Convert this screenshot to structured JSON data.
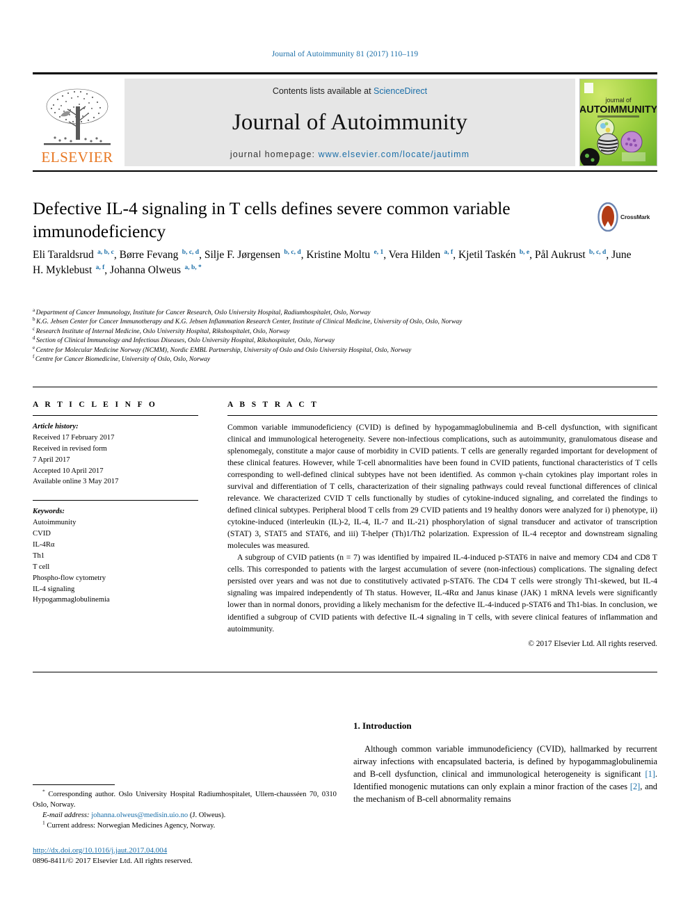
{
  "running_head": "Journal of Autoimmunity 81 (2017) 110–119",
  "masthead": {
    "publisher_name": "ELSEVIER",
    "contents_prefix": "Contents lists available at ",
    "contents_link": "ScienceDirect",
    "journal_title": "Journal of Autoimmunity",
    "homepage_prefix": "journal homepage: ",
    "homepage_url": "www.elsevier.com/locate/jautimm",
    "cover_line1": "journal of",
    "cover_line2": "AUTOIMMUNITY"
  },
  "badge": {
    "crossmark_label": "CrossMark"
  },
  "article": {
    "title": "Defective IL-4 signaling in T cells defines severe common variable immunodeficiency",
    "authors_html": "Eli Taraldsrud <sup>a, b, c</sup>, Børre Fevang <sup>b, c, d</sup>, Silje F. Jørgensen <sup>b, c, d</sup>, Kristine Moltu <sup>e, 1</sup>, Vera Hilden <sup>a, f</sup>, Kjetil Taskén <sup>b, e</sup>, Pål Aukrust <sup>b, c, d</sup>, June H. Myklebust <sup>a, f</sup>, Johanna Olweus <sup>a, b, *</sup>",
    "affiliations": [
      {
        "marker": "a",
        "text": "Department of Cancer Immunology, Institute for Cancer Research, Oslo University Hospital, Radiumhospitalet, Oslo, Norway"
      },
      {
        "marker": "b",
        "text": "K.G. Jebsen Center for Cancer Immunotherapy and K.G. Jebsen Inflammation Research Center, Institute of Clinical Medicine, University of Oslo, Oslo, Norway"
      },
      {
        "marker": "c",
        "text": "Research Institute of Internal Medicine, Oslo University Hospital, Rikshospitalet, Oslo, Norway"
      },
      {
        "marker": "d",
        "text": "Section of Clinical Immunology and Infectious Diseases, Oslo University Hospital, Rikshospitalet, Oslo, Norway"
      },
      {
        "marker": "e",
        "text": "Centre for Molecular Medicine Norway (NCMM), Nordic EMBL Partnership, University of Oslo and Oslo University Hospital, Oslo, Norway"
      },
      {
        "marker": "f",
        "text": "Centre for Cancer Biomedicine, University of Oslo, Oslo, Norway"
      }
    ]
  },
  "article_info": {
    "heading": "A R T I C L E   I N F O",
    "history_label": "Article history:",
    "history": [
      "Received 17 February 2017",
      "Received in revised form",
      "7 April 2017",
      "Accepted 10 April 2017",
      "Available online 3 May 2017"
    ],
    "keywords_label": "Keywords:",
    "keywords": [
      "Autoimmunity",
      "CVID",
      "IL-4Rα",
      "Th1",
      "T cell",
      "Phospho-flow cytometry",
      "IL-4 signaling",
      "Hypogammaglobulinemia"
    ]
  },
  "abstract": {
    "heading": "A B S T R A C T",
    "paragraphs": [
      "Common variable immunodeficiency (CVID) is defined by hypogammaglobulinemia and B-cell dysfunction, with significant clinical and immunological heterogeneity. Severe non-infectious complications, such as autoimmunity, granulomatous disease and splenomegaly, constitute a major cause of morbidity in CVID patients. T cells are generally regarded important for development of these clinical features. However, while T-cell abnormalities have been found in CVID patients, functional characteristics of T cells corresponding to well-defined clinical subtypes have not been identified. As common γ-chain cytokines play important roles in survival and differentiation of T cells, characterization of their signaling pathways could reveal functional differences of clinical relevance. We characterized CVID T cells functionally by studies of cytokine-induced signaling, and correlated the findings to defined clinical subtypes. Peripheral blood T cells from 29 CVID patients and 19 healthy donors were analyzed for i) phenotype, ii) cytokine-induced (interleukin (IL)-2, IL-4, IL-7 and IL-21) phosphorylation of signal transducer and activator of transcription (STAT) 3, STAT5 and STAT6, and iii) T-helper (Th)1/Th2 polarization. Expression of IL-4 receptor and downstream signaling molecules was measured.",
      "A subgroup of CVID patients (n = 7) was identified by impaired IL-4-induced p-STAT6 in naive and memory CD4 and CD8 T cells. This corresponded to patients with the largest accumulation of severe (non-infectious) complications. The signaling defect persisted over years and was not due to constitutively activated p-STAT6. The CD4 T cells were strongly Th1-skewed, but IL-4 signaling was impaired independently of Th status. However, IL-4Rα and Janus kinase (JAK) 1 mRNA levels were significantly lower than in normal donors, providing a likely mechanism for the defective IL-4-induced p-STAT6 and Th1-bias. In conclusion, we identified a subgroup of CVID patients with defective IL-4 signaling in T cells, with severe clinical features of inflammation and autoimmunity."
    ],
    "copyright": "© 2017 Elsevier Ltd. All rights reserved."
  },
  "body": {
    "section_heading": "1. Introduction",
    "paragraph_html": "Although common variable immunodeficiency (CVID), hallmarked by recurrent airway infections with encapsulated bacteria, is defined by hypogammaglobulinemia and B-cell dysfunction, clinical and immunological heterogeneity is significant <span class=\"ref\">[1]</span>. Identified monogenic mutations can only explain a minor fraction of the cases <span class=\"ref\">[2]</span>, and the mechanism of B-cell abnormality remains"
  },
  "footnotes": {
    "corresponding_marker": "*",
    "corresponding_text": "Corresponding author. Oslo University Hospital Radiumhospitalet, Ullern-chausséen 70, 0310 Oslo, Norway.",
    "email_label": "E-mail address:",
    "email": "johanna.olweus@medisin.uio.no",
    "email_suffix": "(J. Olweus).",
    "current_address_marker": "1",
    "current_address_text": "Current address: Norwegian Medicines Agency, Norway."
  },
  "footer": {
    "doi_url": "http://dx.doi.org/10.1016/j.jaut.2017.04.004",
    "issn_line": "0896-8411/© 2017 Elsevier Ltd. All rights reserved."
  },
  "colors": {
    "link_blue": "#1a6ea8",
    "elsevier_orange": "#e87722",
    "masthead_grey": "#e6e6e6",
    "cover_green": "#8dc63f"
  }
}
